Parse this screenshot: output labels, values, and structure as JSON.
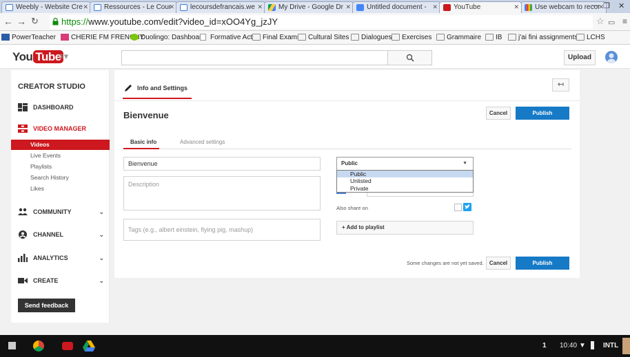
{
  "browser": {
    "tabs": [
      {
        "label": "Weebly - Website Cre",
        "icon": "weebly-icon"
      },
      {
        "label": "Ressources - Le Cour",
        "icon": "weebly-icon"
      },
      {
        "label": "lecoursdefrancais.we",
        "icon": "weebly-icon"
      },
      {
        "label": "My Drive - Google Dr",
        "icon": "drive-icon"
      },
      {
        "label": "Untitled document -",
        "icon": "docs-icon"
      },
      {
        "label": "YouTube",
        "icon": "youtube-icon"
      },
      {
        "label": "Use webcam to recor",
        "icon": "google-icon"
      }
    ],
    "url_scheme": "https://",
    "url_rest": "www.youtube.com/edit?video_id=xOO4Yg_jzJY",
    "bookmarks": [
      {
        "label": "PowerTeacher",
        "icon": "powerteacher-icon"
      },
      {
        "label": "CHERIE FM FRENCHY",
        "icon": "cherie-icon"
      },
      {
        "label": "Duolingo: Dashboard",
        "icon": "duolingo-icon"
      },
      {
        "label": "Formative Acts",
        "icon": "doc-icon"
      },
      {
        "label": "Final Exams",
        "icon": "folder-icon"
      },
      {
        "label": "Cultural Sites",
        "icon": "folder-icon"
      },
      {
        "label": "Dialogues",
        "icon": "folder-icon"
      },
      {
        "label": "Exercises",
        "icon": "folder-icon"
      },
      {
        "label": "Grammaire",
        "icon": "folder-icon"
      },
      {
        "label": "IB",
        "icon": "folder-icon"
      },
      {
        "label": "j'ai fini assignments",
        "icon": "folder-icon"
      },
      {
        "label": "LCHS",
        "icon": "folder-icon"
      }
    ]
  },
  "header": {
    "logo_you": "You",
    "logo_tube": "Tube",
    "upload_label": "Upload"
  },
  "sidebar": {
    "title": "CREATOR STUDIO",
    "dashboard": "DASHBOARD",
    "video_manager": "VIDEO MANAGER",
    "items": [
      "Videos",
      "Live Events",
      "Playlists",
      "Search History",
      "Likes"
    ],
    "community": "COMMUNITY",
    "channel": "CHANNEL",
    "analytics": "ANALYTICS",
    "create": "CREATE",
    "feedback": "Send feedback"
  },
  "main": {
    "tab_label": "Info and Settings",
    "video_title": "Bienvenue",
    "cancel_label": "Cancel",
    "publish_label": "Publish",
    "subtabs": [
      "Basic info",
      "Advanced settings"
    ],
    "title_value": "Bienvenue",
    "description_placeholder": "Description",
    "tags_placeholder": "Tags (e.g., albert einstein, flying pig, mashup)",
    "privacy_selected": "Public",
    "privacy_options": [
      "Public",
      "Unlisted",
      "Private"
    ],
    "also_share": "Also share on",
    "add_playlist": "+ Add to playlist",
    "unsaved_notice": "Some changes are not yet saved."
  },
  "taskbar": {
    "badge": "1",
    "time": "10:40",
    "lang": "INTL"
  },
  "colors": {
    "youtube_red": "#cc181e",
    "publish_blue": "#167ac6"
  }
}
